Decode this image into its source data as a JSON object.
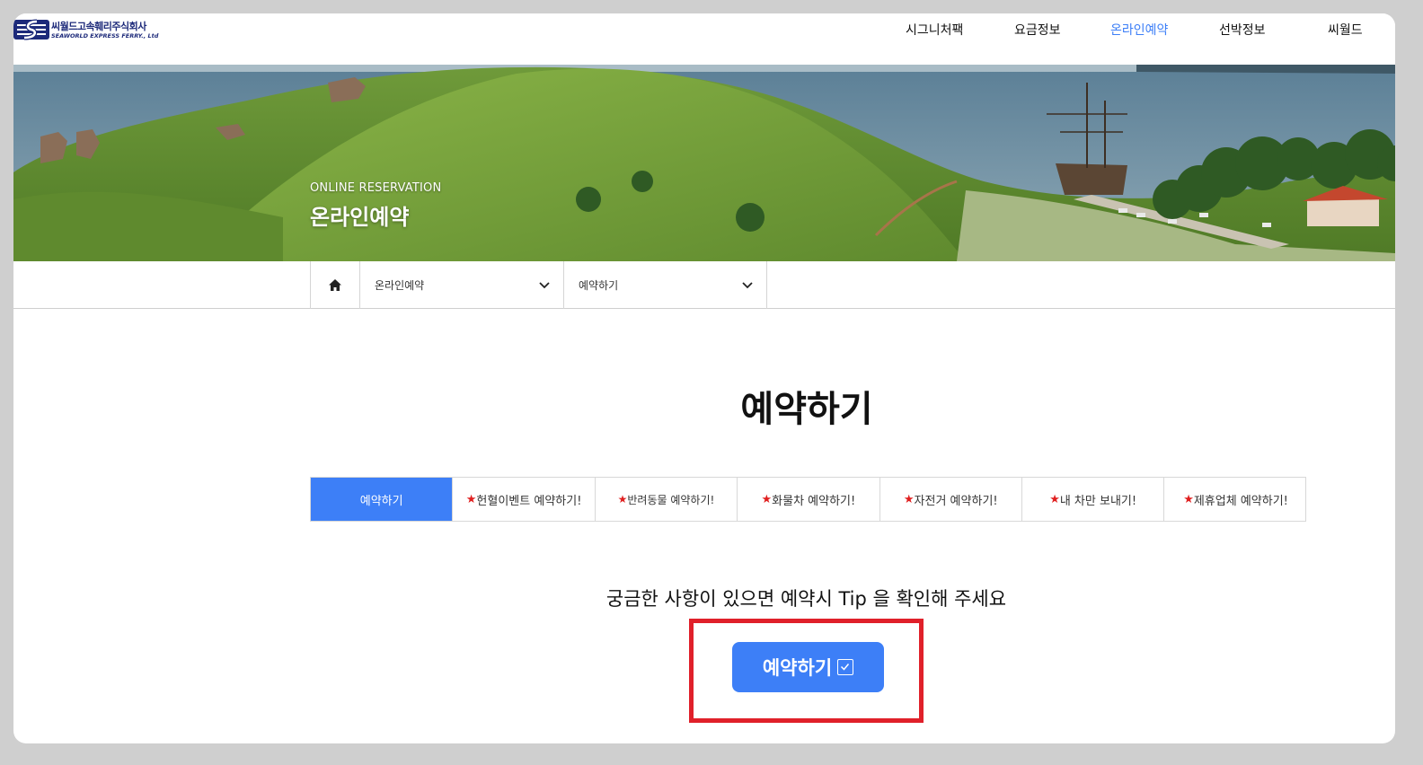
{
  "brand": {
    "name_ko": "씨월드고속훼리주식회사",
    "name_en": "SEAWORLD EXPRESS FERRY., Ltd",
    "color": "#1d2a7a"
  },
  "nav": {
    "items": [
      {
        "label": "시그니처팩",
        "active": false
      },
      {
        "label": "요금정보",
        "active": false
      },
      {
        "label": "온라인예약",
        "active": true
      },
      {
        "label": "선박정보",
        "active": false
      },
      {
        "label": "씨월드",
        "active": false
      }
    ],
    "active_color": "#3d7ff7"
  },
  "hero": {
    "subtitle": "ONLINE RESERVATION",
    "title": "온라인예약"
  },
  "breadcrumb": {
    "home_icon": "home-icon",
    "level1": "온라인예약",
    "level2": "예약하기"
  },
  "main": {
    "title": "예약하기",
    "tabs": [
      {
        "label": "예약하기",
        "star": false,
        "active": true
      },
      {
        "label": "헌혈이벤트 예약하기!",
        "star": true,
        "active": false
      },
      {
        "label": "반려동물 예약하기!",
        "star": true,
        "active": false
      },
      {
        "label": "화물차 예약하기!",
        "star": true,
        "active": false
      },
      {
        "label": "자전거 예약하기!",
        "star": true,
        "active": false
      },
      {
        "label": "내 차만 보내기!",
        "star": true,
        "active": false
      },
      {
        "label": "제휴업체 예약하기!",
        "star": true,
        "active": false
      }
    ],
    "star_glyph": "★",
    "tip": "궁금한 사항이 있으면 예약시 Tip 을 확인해 주세요",
    "cta_label": "예약하기",
    "cta_icon": "checkbox-icon",
    "accent": "#3d7ff7",
    "highlight_color": "#e0202a"
  }
}
